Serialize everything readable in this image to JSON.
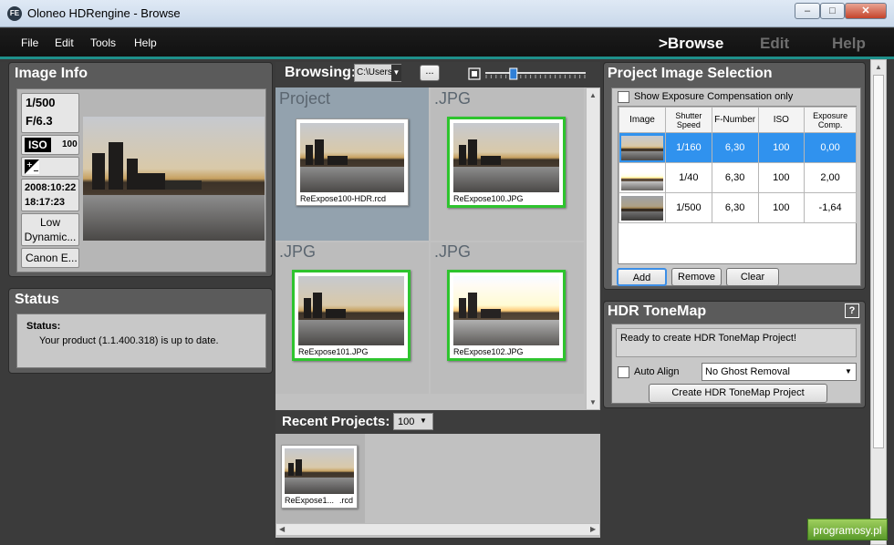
{
  "window": {
    "title": "Oloneo HDRengine - Browse",
    "icon_text": "FE",
    "minimize": "–",
    "maximize": "□",
    "close": "✕"
  },
  "menu": {
    "items": [
      "File",
      "Edit",
      "Tools",
      "Help"
    ]
  },
  "modes": {
    "browse": ">Browse",
    "edit": "Edit",
    "help": "Help"
  },
  "image_info": {
    "title": "Image Info",
    "shutter": "1/500",
    "aperture": "F/6.3",
    "iso_label": "ISO",
    "iso_value": "100",
    "date": "2008:10:22",
    "time": "18:17:23",
    "range_line1": "Low",
    "range_line2": "Dynamic...",
    "camera": "Canon E..."
  },
  "status": {
    "title": "Status",
    "label": "Status:",
    "message": "Your product (1.1.400.318) is up to date."
  },
  "browsing": {
    "label": "Browsing:",
    "path": "C:\\Users",
    "browse_button": "...",
    "zoom_level": 0.28,
    "cells": [
      {
        "header": "Project",
        "caption": "ReExpose100-HDR.rcd",
        "selected": false
      },
      {
        "header": ".JPG",
        "caption": "ReExpose100.JPG",
        "selected": true
      },
      {
        "header": ".JPG",
        "caption": "ReExpose101.JPG",
        "selected": true
      },
      {
        "header": ".JPG",
        "caption": "ReExpose102.JPG",
        "selected": true
      }
    ]
  },
  "recent": {
    "label": "Recent Projects:",
    "count": "100",
    "items": [
      {
        "caption_left": "ReExpose1...",
        "caption_right": ".rcd"
      }
    ]
  },
  "selection": {
    "title": "Project Image Selection",
    "checkbox_label": "Show Exposure Compensation only",
    "columns": [
      "Image",
      "Shutter Speed",
      "F-Number",
      "ISO",
      "Exposure Comp."
    ],
    "rows": [
      {
        "shutter": "1/160",
        "fnumber": "6,30",
        "iso": "100",
        "comp": "0,00",
        "selected": true
      },
      {
        "shutter": "1/40",
        "fnumber": "6,30",
        "iso": "100",
        "comp": "2,00",
        "selected": false
      },
      {
        "shutter": "1/500",
        "fnumber": "6,30",
        "iso": "100",
        "comp": "-1,64",
        "selected": false
      }
    ],
    "add": "Add",
    "remove": "Remove",
    "clear": "Clear"
  },
  "tonemap": {
    "title": "HDR ToneMap",
    "help": "?",
    "message": "Ready to create HDR ToneMap Project!",
    "auto_align": "Auto Align",
    "ghost_option": "No Ghost Removal",
    "create": "Create HDR ToneMap Project"
  },
  "watermark": "programosy.pl",
  "colors": {
    "accent": "#1e8f8a",
    "selection_border": "#2ec42e",
    "row_selected": "#3092ee"
  }
}
